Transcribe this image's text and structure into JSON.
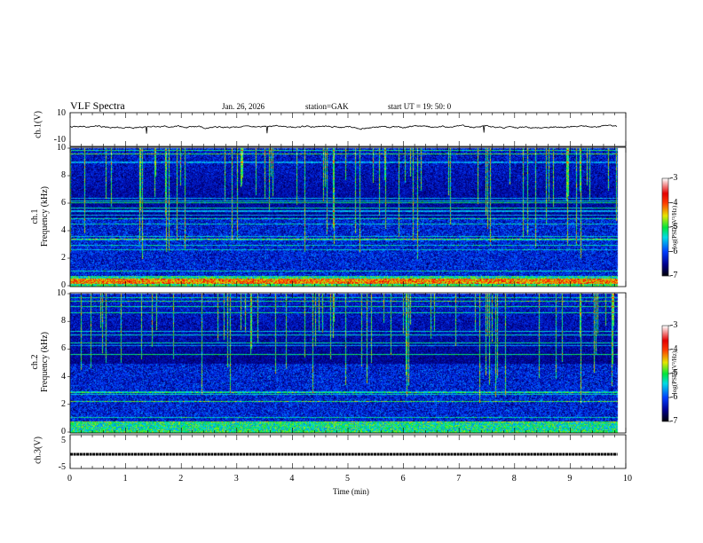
{
  "header": {
    "title": "VLF Spectra",
    "date": "Jan. 26, 2026",
    "station": "station=GAK",
    "start_ut": "start  UT =   19: 50: 0"
  },
  "chart_data": [
    {
      "type": "line",
      "ylabel": "ch.1(V)",
      "ylim": [
        -10,
        10
      ],
      "yticks": [
        "10",
        "-10"
      ],
      "xlim": [
        0,
        10
      ],
      "description_series": "noisy waveform near -1 V"
    },
    {
      "type": "heatmap",
      "ylabel": "ch.1\nFrequency (kHz)",
      "ylabel_line1": "ch.1",
      "ylabel_line2": "Frequency  (kHz)",
      "ylim": [
        0,
        10
      ],
      "yticks": [
        "0",
        "2",
        "4",
        "6",
        "8",
        "10"
      ],
      "xlim": [
        0,
        10
      ],
      "colorbar": {
        "label": "log(PSD)(V²/Hz)",
        "range": [
          -7,
          -3
        ],
        "ticks": [
          "-3",
          "-4",
          "-5",
          "-6",
          "-7"
        ]
      }
    },
    {
      "type": "heatmap",
      "ylabel_line1": "ch.2",
      "ylabel_line2": "Frequency  (kHz)",
      "ylim": [
        0,
        10
      ],
      "yticks": [
        "0",
        "2",
        "4",
        "6",
        "8",
        "10"
      ],
      "xlim": [
        0,
        10
      ],
      "colorbar": {
        "label": "log(PSD)(V²/Hz)",
        "range": [
          -7,
          -3
        ],
        "ticks": [
          "-3",
          "-4",
          "-5",
          "-6",
          "-7"
        ]
      }
    },
    {
      "type": "line",
      "ylabel": "ch.3(V)",
      "ylim": [
        -5,
        5
      ],
      "yticks": [
        "5",
        "-5"
      ],
      "xlim": [
        0,
        10
      ],
      "xlabel": "Time  (min)",
      "xticks": [
        "0",
        "1",
        "2",
        "3",
        "4",
        "5",
        "6",
        "7",
        "8",
        "9",
        "10"
      ]
    }
  ],
  "colors": {
    "trace": "#000000",
    "background": "#000000"
  }
}
